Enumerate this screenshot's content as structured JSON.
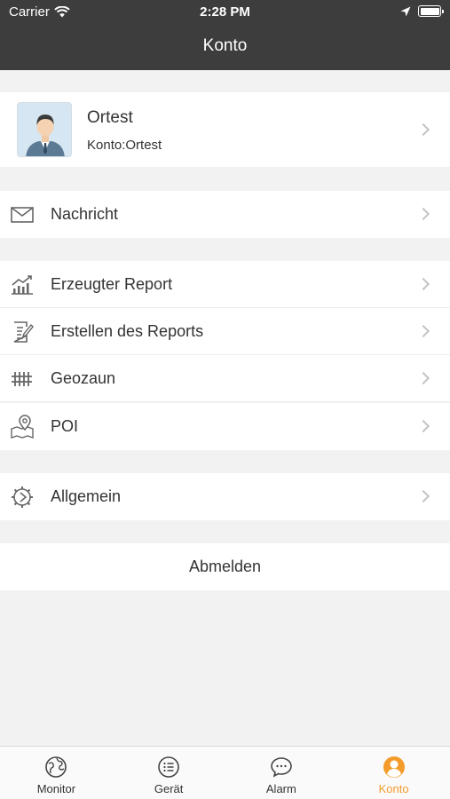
{
  "status_bar": {
    "carrier": "Carrier",
    "time": "2:28 PM"
  },
  "header": {
    "title": "Konto"
  },
  "profile": {
    "name": "Ortest",
    "account": "Konto:Ortest"
  },
  "menu": {
    "message": "Nachricht",
    "generated_report": "Erzeugter Report",
    "create_report": "Erstellen des Reports",
    "geofence": "Geozaun",
    "poi": "POI",
    "general": "Allgemein"
  },
  "logout_label": "Abmelden",
  "tabs": [
    {
      "label": "Monitor",
      "icon": "globe-icon"
    },
    {
      "label": "Gerät",
      "icon": "list-icon"
    },
    {
      "label": "Alarm",
      "icon": "chat-bubble-icon"
    },
    {
      "label": "Konto",
      "icon": "person-icon"
    }
  ],
  "colors": {
    "header": "#3d3d3d",
    "accent": "#f39c2b",
    "background": "#f2f2f2"
  }
}
